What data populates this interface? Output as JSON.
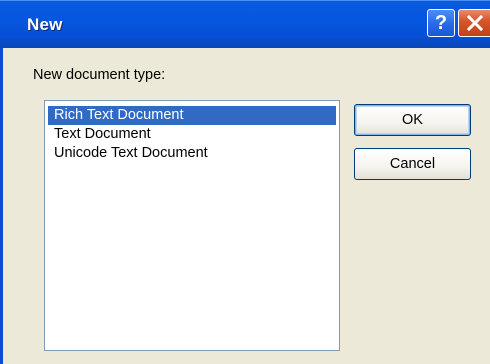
{
  "window": {
    "title": "New"
  },
  "titlebar": {
    "help_label": "?",
    "close_label": "✕"
  },
  "dialog": {
    "prompt": "New document type:",
    "document_types": [
      {
        "label": "Rich Text Document",
        "selected": true
      },
      {
        "label": "Text Document",
        "selected": false
      },
      {
        "label": "Unicode Text Document",
        "selected": false
      }
    ],
    "ok_label": "OK",
    "cancel_label": "Cancel"
  },
  "colors": {
    "titlebar": "#0756e0",
    "selection": "#316ac5",
    "dialog_bg": "#ece9d8"
  }
}
